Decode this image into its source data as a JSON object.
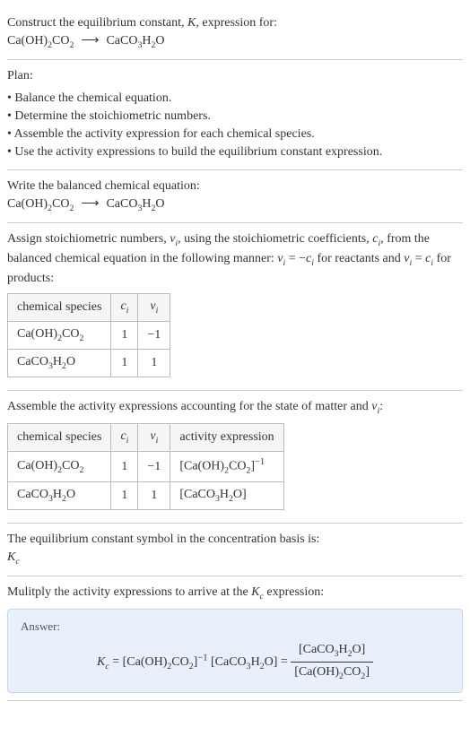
{
  "intro": {
    "line1_prefix": "Construct the equilibrium constant, ",
    "line1_k": "K",
    "line1_suffix": ", expression for:"
  },
  "plan": {
    "title": "Plan:",
    "items": [
      "Balance the chemical equation.",
      "Determine the stoichiometric numbers.",
      "Assemble the activity expression for each chemical species.",
      "Use the activity expressions to build the equilibrium constant expression."
    ]
  },
  "balanced": {
    "title": "Write the balanced chemical equation:"
  },
  "stoich": {
    "intro1": "Assign stoichiometric numbers, ",
    "intro2": ", using the stoichiometric coefficients, ",
    "intro3": ", from the balanced chemical equation in the following manner: ",
    "intro4": " for reactants and ",
    "intro5": " for products:",
    "nu_i": "ν",
    "c_i": "c",
    "eq_react": " = −",
    "eq_prod": " = ",
    "headers": {
      "species": "chemical species",
      "ci": "c",
      "nui": "ν"
    },
    "rows": [
      {
        "c": "1",
        "nu": "−1"
      },
      {
        "c": "1",
        "nu": "1"
      }
    ]
  },
  "activity": {
    "title": "Assemble the activity expressions accounting for the state of matter and ",
    "title_suffix": ":",
    "headers": {
      "species": "chemical species",
      "ci": "c",
      "nui": "ν",
      "act": "activity expression"
    },
    "rows": [
      {
        "c": "1",
        "nu": "−1"
      },
      {
        "c": "1",
        "nu": "1"
      }
    ]
  },
  "kc_symbol": {
    "title": "The equilibrium constant symbol in the concentration basis is:",
    "sym": "K",
    "sub": "c"
  },
  "multiply": {
    "title_prefix": "Mulitply the activity expressions to arrive at the ",
    "title_suffix": " expression:"
  },
  "answer": {
    "label": "Answer:"
  }
}
